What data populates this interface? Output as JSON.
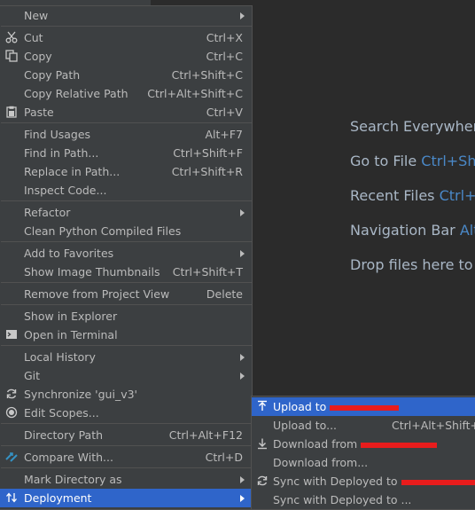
{
  "background_hints": [
    {
      "text": "Search Everywhere",
      "shortcut": ""
    },
    {
      "text": "Go to File",
      "shortcut": "Ctrl+Sh"
    },
    {
      "text": "Recent Files",
      "shortcut": "Ctrl+"
    },
    {
      "text": "Navigation Bar",
      "shortcut": "Alt"
    },
    {
      "text": "Drop files here to o",
      "shortcut": ""
    }
  ],
  "menu": {
    "items": [
      {
        "label": "New",
        "shortcut": "",
        "submenu": true
      },
      {
        "label": "Cut",
        "shortcut": "Ctrl+X",
        "icon": "scissors-icon"
      },
      {
        "label": "Copy",
        "shortcut": "Ctrl+C",
        "icon": "copy-icon"
      },
      {
        "label": "Copy Path",
        "shortcut": "Ctrl+Shift+C"
      },
      {
        "label": "Copy Relative Path",
        "shortcut": "Ctrl+Alt+Shift+C"
      },
      {
        "label": "Paste",
        "shortcut": "Ctrl+V",
        "icon": "paste-icon"
      },
      {
        "label": "Find Usages",
        "shortcut": "Alt+F7"
      },
      {
        "label": "Find in Path...",
        "shortcut": "Ctrl+Shift+F"
      },
      {
        "label": "Replace in Path...",
        "shortcut": "Ctrl+Shift+R"
      },
      {
        "label": "Inspect Code...",
        "shortcut": ""
      },
      {
        "label": "Refactor",
        "shortcut": "",
        "submenu": true
      },
      {
        "label": "Clean Python Compiled Files",
        "shortcut": ""
      },
      {
        "label": "Add to Favorites",
        "shortcut": "",
        "submenu": true
      },
      {
        "label": "Show Image Thumbnails",
        "shortcut": "Ctrl+Shift+T"
      },
      {
        "label": "Remove from Project View",
        "shortcut": "Delete"
      },
      {
        "label": "Show in Explorer",
        "shortcut": ""
      },
      {
        "label": "Open in Terminal",
        "shortcut": "",
        "icon": "terminal-icon"
      },
      {
        "label": "Local History",
        "shortcut": "",
        "submenu": true
      },
      {
        "label": "Git",
        "shortcut": "",
        "submenu": true
      },
      {
        "label": "Synchronize 'gui_v3'",
        "shortcut": "",
        "icon": "sync-icon"
      },
      {
        "label": "Edit Scopes...",
        "shortcut": "",
        "icon": "scope-icon"
      },
      {
        "label": "Directory Path",
        "shortcut": "Ctrl+Alt+F12"
      },
      {
        "label": "Compare With...",
        "shortcut": "Ctrl+D",
        "icon": "compare-icon"
      },
      {
        "label": "Mark Directory as",
        "shortcut": "",
        "submenu": true
      },
      {
        "label": "Deployment",
        "shortcut": "",
        "submenu": true,
        "icon": "deployment-icon",
        "selected": true
      }
    ]
  },
  "submenu": {
    "items": [
      {
        "label": "Upload to",
        "shortcut": "",
        "icon": "upload-icon",
        "selected": true
      },
      {
        "label": "Upload to...",
        "shortcut": "Ctrl+Alt+Shift+X"
      },
      {
        "label": "Download from",
        "shortcut": "",
        "icon": "download-icon"
      },
      {
        "label": "Download from...",
        "shortcut": ""
      },
      {
        "label": "Sync with Deployed to",
        "shortcut": "",
        "icon": "sync-icon"
      },
      {
        "label": "Sync with Deployed to ...",
        "shortcut": ""
      }
    ]
  },
  "colors": {
    "menu_bg": "#3c3f41",
    "selection": "#2f65ca",
    "editor_bg": "#2b2b2b",
    "shortcut_blue": "#4a88c7",
    "redaction": "#e81c1c"
  }
}
